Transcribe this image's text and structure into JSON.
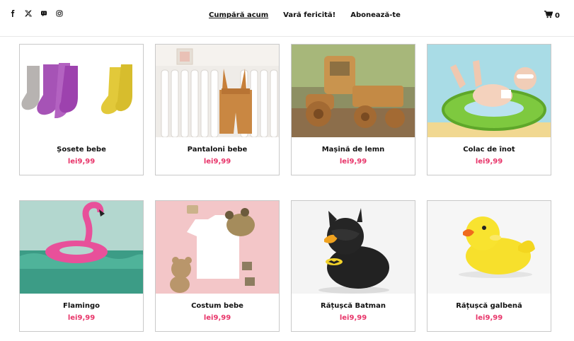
{
  "social": [
    {
      "icon": "facebook-icon"
    },
    {
      "icon": "x-twitter-icon"
    },
    {
      "icon": "discord-icon"
    },
    {
      "icon": "instagram-icon"
    }
  ],
  "nav": {
    "items": [
      {
        "label": "Cumpără acum",
        "active": true
      },
      {
        "label": "Vară fericită!",
        "active": false
      },
      {
        "label": "Abonează-te",
        "active": false
      }
    ]
  },
  "cart": {
    "icon": "cart-icon",
    "count": "0"
  },
  "colors": {
    "price": "#e8356a",
    "border": "#c9c9c9"
  },
  "products": [
    {
      "name": "Șosete bebe",
      "price": "lei9,99"
    },
    {
      "name": "Pantaloni bebe",
      "price": "lei9,99"
    },
    {
      "name": "Mașină de lemn",
      "price": "lei9,99"
    },
    {
      "name": "Colac de înot",
      "price": "lei9,99"
    },
    {
      "name": "Flamingo",
      "price": "lei9,99"
    },
    {
      "name": "Costum bebe",
      "price": "lei9,99"
    },
    {
      "name": "Rățușcă Batman",
      "price": "lei9,99"
    },
    {
      "name": "Rățușcă galbenă",
      "price": "lei9,99"
    }
  ]
}
